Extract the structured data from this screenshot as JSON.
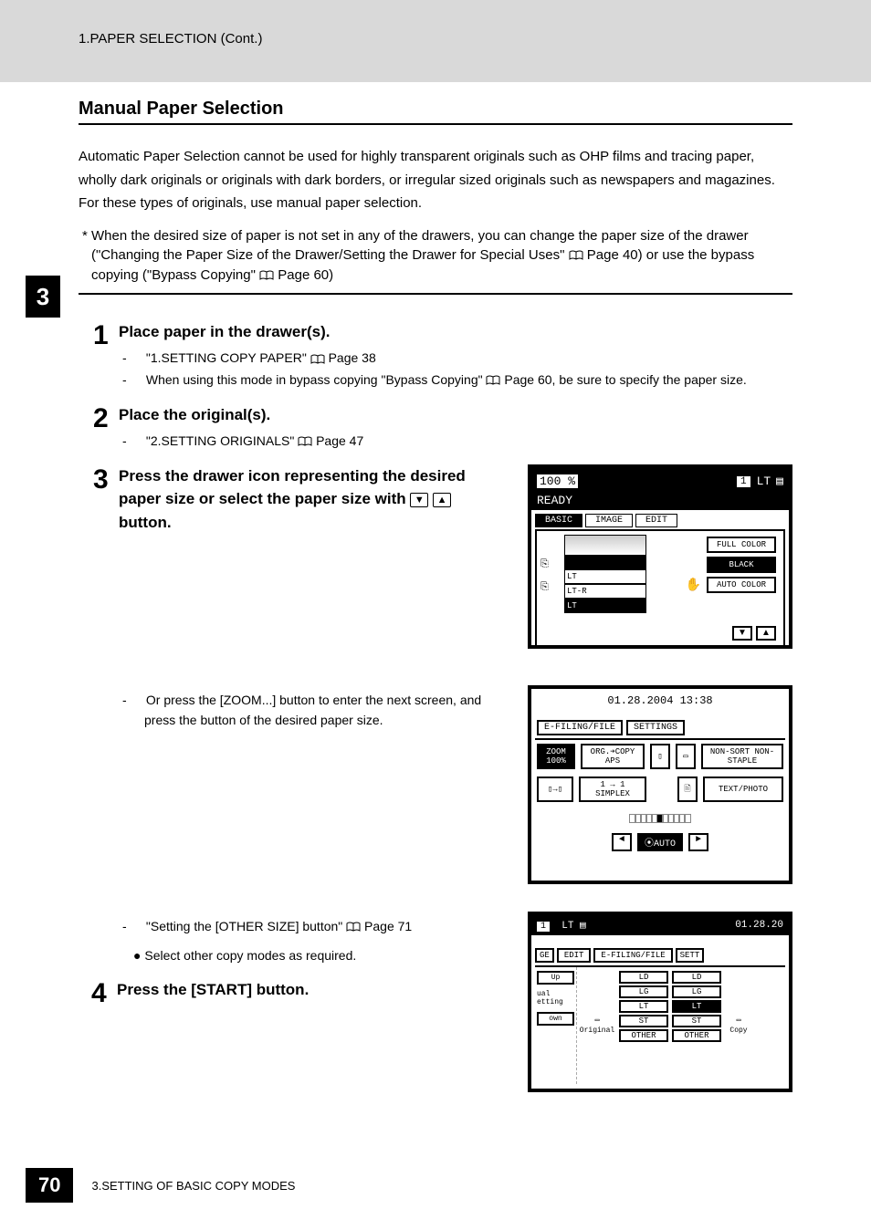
{
  "header": {
    "breadcrumb": "1.PAPER SELECTION (Cont.)"
  },
  "chapter_tab": "3",
  "section": {
    "title": "Manual Paper Selection"
  },
  "intro": "Automatic Paper Selection cannot be used for highly transparent originals such as OHP films and tracing paper, wholly dark originals or originals with dark borders, or irregular sized originals such as newspapers and magazines. For these types of originals, use manual paper selection.",
  "asterisk_note": {
    "prefix": "*",
    "text_a": "When the desired size of paper is not set in any of the drawers, you can change the paper size of the drawer (\"Changing the Paper Size of the Drawer/Setting the Drawer for Special Uses\"",
    "ref_a": "Page 40",
    "text_b": ") or use the bypass copying (\"Bypass Copying\"",
    "ref_b": "Page 60",
    "text_c": ")"
  },
  "steps": {
    "s1": {
      "num": "1",
      "title": "Place paper in the drawer(s).",
      "items": [
        {
          "dash": "-",
          "text": "\"1.SETTING COPY PAPER\"",
          "ref": "Page 38"
        },
        {
          "dash": "-",
          "text": "When using this mode in bypass copying \"Bypass Copying\"",
          "ref": "Page 60",
          "tail": ", be sure to specify the paper size."
        }
      ]
    },
    "s2": {
      "num": "2",
      "title": "Place the original(s).",
      "items": [
        {
          "dash": "-",
          "text": "\"2.SETTING ORIGINALS\"",
          "ref": "Page 47"
        }
      ]
    },
    "s3": {
      "num": "3",
      "title_a": "Press the drawer icon representing the desired paper size or select the paper size with ",
      "title_b": " button.",
      "zoom_item": {
        "dash": "-",
        "text": "Or press the [ZOOM...] button to enter the next screen, and press the button of the desired paper size."
      },
      "other_item": {
        "dash": "-",
        "text": "\"Setting the [OTHER SIZE] button\"",
        "ref": "Page 71"
      },
      "bullet_item": {
        "bullet": "●",
        "text": "Select other copy modes as required."
      }
    },
    "s4": {
      "num": "4",
      "title": "Press the [START] button."
    }
  },
  "screens": {
    "sc1": {
      "zoom": "100 %",
      "count": "1",
      "size_badge": "LT",
      "ready": "READY",
      "tabs": {
        "basic": "BASIC",
        "image": "IMAGE",
        "edit": "EDIT"
      },
      "drawers": {
        "lt": "LT",
        "ltr": "LT-R",
        "lt2": "LT"
      },
      "side": {
        "full": "FULL COLOR",
        "black": "BLACK",
        "auto": "AUTO COLOR"
      }
    },
    "sc2": {
      "datetime": "01.28.2004 13:38",
      "tabs": {
        "efile": "E-FILING/FILE",
        "settings": "SETTINGS"
      },
      "row1": {
        "zoom": "ZOOM 100%",
        "orgcopy": "ORG.➔COPY APS",
        "nonsort": "NON-SORT NON-STAPLE"
      },
      "row2": {
        "simplex": "1 → 1 SIMPLEX",
        "textphoto": "TEXT/PHOTO"
      },
      "auto_btn": "AUTO",
      "left_arrow": "◄",
      "right_arrow": "►"
    },
    "sc3": {
      "count": "1",
      "size_badge": "LT",
      "datetime": "01.28.20",
      "tabs": {
        "ge": "GE",
        "edit": "EDIT",
        "efile": "E-FILING/FILE",
        "sett": "SETT"
      },
      "left": {
        "up": "Up",
        "ual": "ual etting",
        "own": "own"
      },
      "original_label": "Original",
      "copy_label": "Copy",
      "sizes": {
        "ld": "LD",
        "lg": "LG",
        "lt": "LT",
        "st": "ST",
        "other": "OTHER"
      }
    }
  },
  "footer": {
    "page": "70",
    "text": "3.SETTING OF BASIC COPY MODES"
  }
}
